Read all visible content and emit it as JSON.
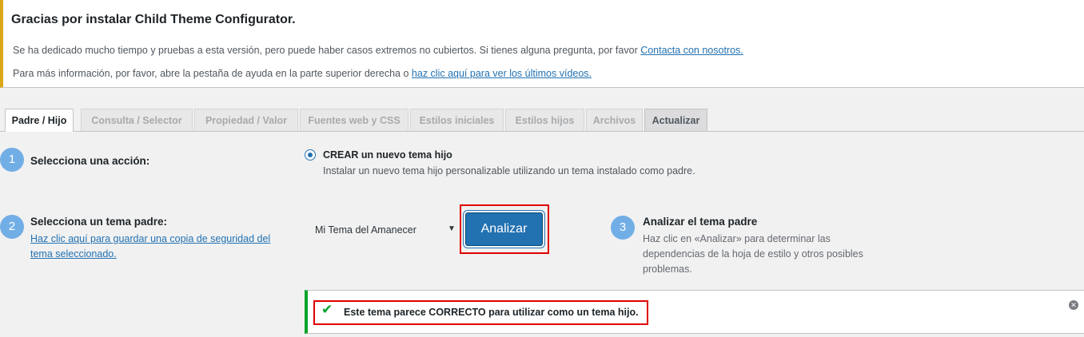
{
  "notice": {
    "title": "Gracias por instalar Child Theme Configurator.",
    "line1_text": "Se ha dedicado mucho tiempo y pruebas a esta versión, pero puede haber casos extremos no cubiertos. Si tienes alguna pregunta, por favor ",
    "line1_link": "Contacta con nosotros.",
    "line2_text": "Para más información, por favor, abre la pestaña de ayuda en la parte superior derecha o ",
    "line2_link": "haz clic aquí para ver los últimos vídeos."
  },
  "tabs": [
    {
      "label": "Padre / Hijo"
    },
    {
      "label": "Consulta / Selector"
    },
    {
      "label": "Propiedad / Valor"
    },
    {
      "label": "Fuentes web y CSS"
    },
    {
      "label": "Estilos iniciales"
    },
    {
      "label": "Estilos hijos"
    },
    {
      "label": "Archivos"
    },
    {
      "label": "Actualizar"
    }
  ],
  "step1": {
    "number": "1",
    "label": "Selecciona una acción:",
    "radio_label": "CREAR un nuevo tema hijo",
    "radio_desc": "Instalar un nuevo tema hijo personalizable utilizando un tema instalado como padre."
  },
  "step2": {
    "number": "2",
    "label": "Selecciona un tema padre:",
    "link": "Haz clic aquí para guardar una copia de seguridad del tema seleccionado.",
    "select_value": "Mi Tema del Amanecer",
    "analyze_label": "Analizar"
  },
  "step3": {
    "number": "3",
    "title": "Analizar el tema padre",
    "desc": "Haz clic en «Analizar» para determinar las dependencias de la hoja de estilo y otros posibles problemas."
  },
  "success": {
    "message": "Este tema parece CORRECTO para utilizar como un tema hijo."
  },
  "colors": {
    "accent": "#2271b1",
    "success": "#00a32a",
    "warning": "#dba617",
    "highlight": "#e00000"
  }
}
